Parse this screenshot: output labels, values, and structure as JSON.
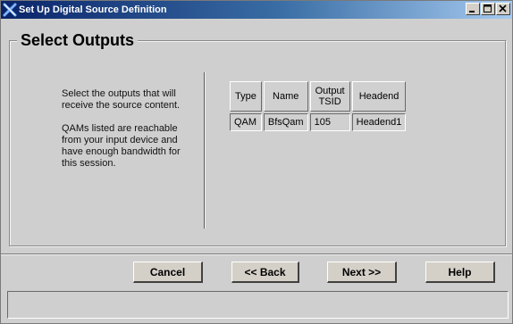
{
  "window": {
    "title": "Set Up Digital Source Definition"
  },
  "section": {
    "title": "Select Outputs"
  },
  "instructions": {
    "paragraph1": "Select the outputs that will receive the source content.",
    "paragraph2": "QAMs listed are reachable from your input device and have enough bandwidth for this session."
  },
  "outputs_table": {
    "headers": {
      "type": "Type",
      "name": "Name",
      "output_tsid_line1": "Output",
      "output_tsid_line2": "TSID",
      "headend": "Headend"
    },
    "rows": [
      {
        "type": "QAM",
        "name": "BfsQam",
        "output_tsid": "105",
        "headend": "Headend1"
      }
    ]
  },
  "buttons": {
    "cancel": "Cancel",
    "back": "<< Back",
    "next": "Next >>",
    "help": "Help"
  },
  "status_bar": {
    "text": ""
  },
  "colors": {
    "titlebar_start": "#0a246a",
    "titlebar_end": "#a6caf0",
    "dialog_background": "#cfcfcf"
  }
}
